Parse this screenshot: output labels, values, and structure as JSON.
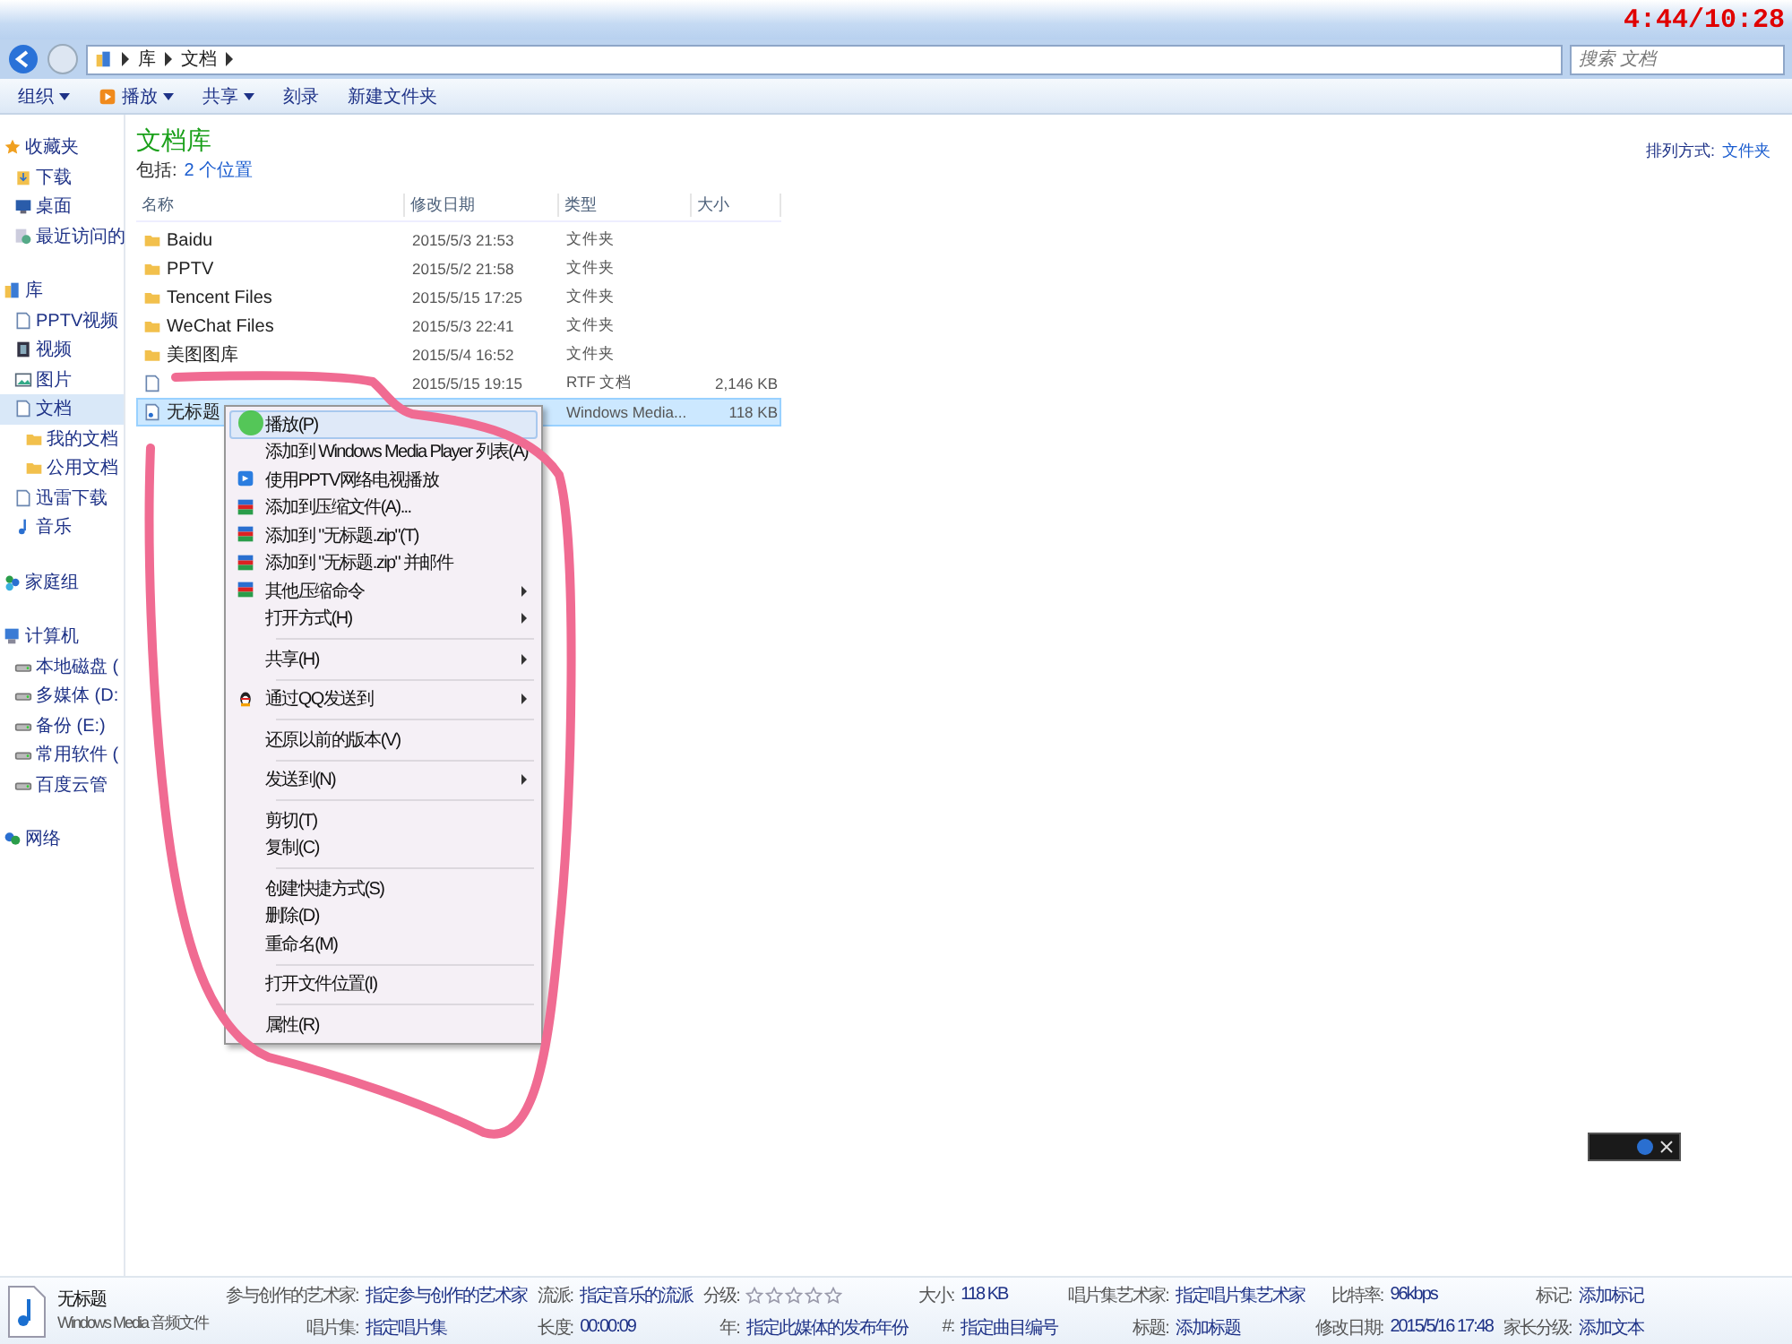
{
  "clock": "4:44/10:28",
  "address": {
    "segments": [
      "库",
      "文档"
    ]
  },
  "search": {
    "placeholder": "搜索 文档"
  },
  "toolbar": [
    {
      "label": "组织",
      "dropdown": true,
      "kind": "plain"
    },
    {
      "label": "播放",
      "dropdown": true,
      "kind": "play"
    },
    {
      "label": "共享",
      "dropdown": true,
      "kind": "plain"
    },
    {
      "label": "刻录",
      "dropdown": false,
      "kind": "plain"
    },
    {
      "label": "新建文件夹",
      "dropdown": false,
      "kind": "plain"
    }
  ],
  "sidebar": {
    "groups": [
      {
        "label": "收藏夹",
        "kind": "star",
        "selected": false,
        "children": [
          {
            "label": "下载",
            "kind": "download",
            "selected": false
          },
          {
            "label": "桌面",
            "kind": "desktop",
            "selected": false
          },
          {
            "label": "最近访问的",
            "kind": "recent",
            "selected": false
          }
        ]
      },
      {
        "label": "库",
        "kind": "library",
        "selected": false,
        "children": [
          {
            "label": "PPTV视频",
            "kind": "doc",
            "selected": false
          },
          {
            "label": "视频",
            "kind": "video",
            "selected": false
          },
          {
            "label": "图片",
            "kind": "picture",
            "selected": false
          },
          {
            "label": "文档",
            "kind": "doc",
            "selected": true,
            "children": [
              {
                "label": "我的文档",
                "kind": "folder",
                "selected": false
              },
              {
                "label": "公用文档",
                "kind": "folder",
                "selected": false
              }
            ]
          },
          {
            "label": "迅雷下载",
            "kind": "doc",
            "selected": false
          },
          {
            "label": "音乐",
            "kind": "music",
            "selected": false
          }
        ]
      },
      {
        "label": "家庭组",
        "kind": "homegroup",
        "selected": false
      },
      {
        "label": "计算机",
        "kind": "computer",
        "selected": false,
        "children": [
          {
            "label": "本地磁盘 (",
            "kind": "drive",
            "selected": false
          },
          {
            "label": "多媒体 (D:",
            "kind": "drive",
            "selected": false
          },
          {
            "label": "备份 (E:)",
            "kind": "drive",
            "selected": false
          },
          {
            "label": "常用软件 (",
            "kind": "drive",
            "selected": false
          },
          {
            "label": "百度云管",
            "kind": "drive",
            "selected": false
          }
        ]
      },
      {
        "label": "网络",
        "kind": "network",
        "selected": false
      }
    ]
  },
  "library": {
    "title": "文档库",
    "includes_label": "包括:",
    "includes_link": "2 个位置",
    "arrange_label": "排列方式:",
    "arrange_value": "文件夹"
  },
  "table": {
    "columns": [
      "名称",
      "修改日期",
      "类型",
      "大小"
    ],
    "rows": [
      {
        "name": "Baidu",
        "date": "2015/5/3 21:53",
        "type": "文件夹",
        "size": "",
        "kind": "folder",
        "selected": false
      },
      {
        "name": "PPTV",
        "date": "2015/5/2 21:58",
        "type": "文件夹",
        "size": "",
        "kind": "folder",
        "selected": false
      },
      {
        "name": "Tencent Files",
        "date": "2015/5/15 17:25",
        "type": "文件夹",
        "size": "",
        "kind": "folder",
        "selected": false
      },
      {
        "name": "WeChat Files",
        "date": "2015/5/3 22:41",
        "type": "文件夹",
        "size": "",
        "kind": "folder",
        "selected": false
      },
      {
        "name": "美图图库",
        "date": "2015/5/4 16:52",
        "type": "文件夹",
        "size": "",
        "kind": "folder",
        "selected": false
      },
      {
        "name": "",
        "date": "2015/5/15 19:15",
        "type": "RTF 文档",
        "size": "2,146 KB",
        "kind": "doc",
        "selected": false
      },
      {
        "name": "无标题",
        "date": "",
        "type": "Windows Media...",
        "size": "118 KB",
        "kind": "audio",
        "selected": true
      }
    ]
  },
  "context_menu": {
    "groups": [
      [
        {
          "label": "播放(P)",
          "kind": "plain",
          "submenu": false,
          "selected": true
        },
        {
          "label": "添加到 Windows Media Player 列表(A)",
          "kind": "plain",
          "submenu": false,
          "selected": false
        },
        {
          "label": "使用PPTV网络电视播放",
          "kind": "pptv",
          "submenu": false,
          "selected": false
        },
        {
          "label": "添加到压缩文件(A)...",
          "kind": "archive",
          "submenu": false,
          "selected": false
        },
        {
          "label": "添加到 \"无标题.zip\"(T)",
          "kind": "archive",
          "submenu": false,
          "selected": false
        },
        {
          "label": "添加到 \"无标题.zip\" 并邮件",
          "kind": "archive",
          "submenu": false,
          "selected": false
        },
        {
          "label": "其他压缩命令",
          "kind": "archive",
          "submenu": true,
          "selected": false
        },
        {
          "label": "打开方式(H)",
          "kind": "plain",
          "submenu": true,
          "selected": false
        }
      ],
      [
        {
          "label": "共享(H)",
          "kind": "plain",
          "submenu": true,
          "selected": false
        }
      ],
      [
        {
          "label": "通过QQ发送到",
          "kind": "qq",
          "submenu": true,
          "selected": false
        }
      ],
      [
        {
          "label": "还原以前的版本(V)",
          "kind": "plain",
          "submenu": false,
          "selected": false
        }
      ],
      [
        {
          "label": "发送到(N)",
          "kind": "plain",
          "submenu": true,
          "selected": false
        }
      ],
      [
        {
          "label": "剪切(T)",
          "kind": "plain",
          "submenu": false,
          "selected": false
        },
        {
          "label": "复制(C)",
          "kind": "plain",
          "submenu": false,
          "selected": false
        }
      ],
      [
        {
          "label": "创建快捷方式(S)",
          "kind": "plain",
          "submenu": false,
          "selected": false
        },
        {
          "label": "删除(D)",
          "kind": "plain",
          "submenu": false,
          "selected": false
        },
        {
          "label": "重命名(M)",
          "kind": "plain",
          "submenu": false,
          "selected": false
        }
      ],
      [
        {
          "label": "打开文件位置(I)",
          "kind": "plain",
          "submenu": false,
          "selected": false
        }
      ],
      [
        {
          "label": "属性(R)",
          "kind": "plain",
          "submenu": false,
          "selected": false
        }
      ]
    ]
  },
  "details": {
    "name": "无标题",
    "type": "Windows Media 音频文件",
    "columns": [
      [
        {
          "label": "参与创作的艺术家:",
          "value": "指定参与创作的艺术家"
        },
        {
          "label": "唱片集:",
          "value": "指定唱片集"
        }
      ],
      [
        {
          "label": "流派:",
          "value": "指定音乐的流派"
        },
        {
          "label": "长度:",
          "value": "00:00:09"
        }
      ],
      [
        {
          "label": "分级:",
          "stars": 0
        },
        {
          "label": "年:",
          "value": "指定此媒体的发布年份"
        }
      ],
      [
        {
          "label": "大小:",
          "value": "118 KB"
        },
        {
          "label": "#:",
          "value": "指定曲目编号"
        }
      ],
      [
        {
          "label": "唱片集艺术家:",
          "value": "指定唱片集艺术家"
        },
        {
          "label": "标题:",
          "value": "添加标题"
        }
      ],
      [
        {
          "label": "比特率:",
          "value": "96kbps"
        },
        {
          "label": "修改日期:",
          "value": "2015/5/16 17:48"
        }
      ],
      [
        {
          "label": "标记:",
          "value": "添加标记"
        },
        {
          "label": "家长分级:",
          "value": "添加文本"
        }
      ]
    ]
  }
}
